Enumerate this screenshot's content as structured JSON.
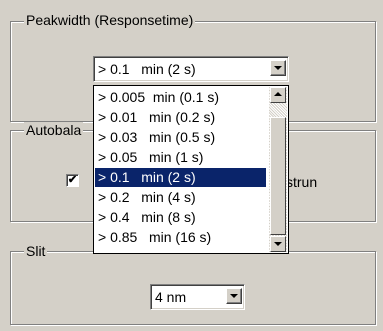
{
  "peakwidth": {
    "title": "Peakwidth  (Responsetime)",
    "selected": "> 0.1   min (2 s)",
    "options": [
      "> 0.005  min (0.1 s)",
      "> 0.01   min (0.2 s)",
      "> 0.03   min (0.5 s)",
      "> 0.05   min (1 s)",
      "> 0.1   min (2 s)",
      "> 0.2   min (4 s)",
      "> 0.4   min (8 s)",
      "> 0.85   min (16 s)"
    ],
    "selected_index": 4
  },
  "autobalance": {
    "title": "Autobala",
    "checkbox_checked": true,
    "checkbox_mark": "✔",
    "label_fragment": "strun"
  },
  "slit": {
    "title": "Slit",
    "value": "4 nm"
  },
  "icons": {
    "dropdown": "chevron-down-icon",
    "scroll_up": "arrow-up-icon",
    "scroll_down": "arrow-down-icon"
  }
}
